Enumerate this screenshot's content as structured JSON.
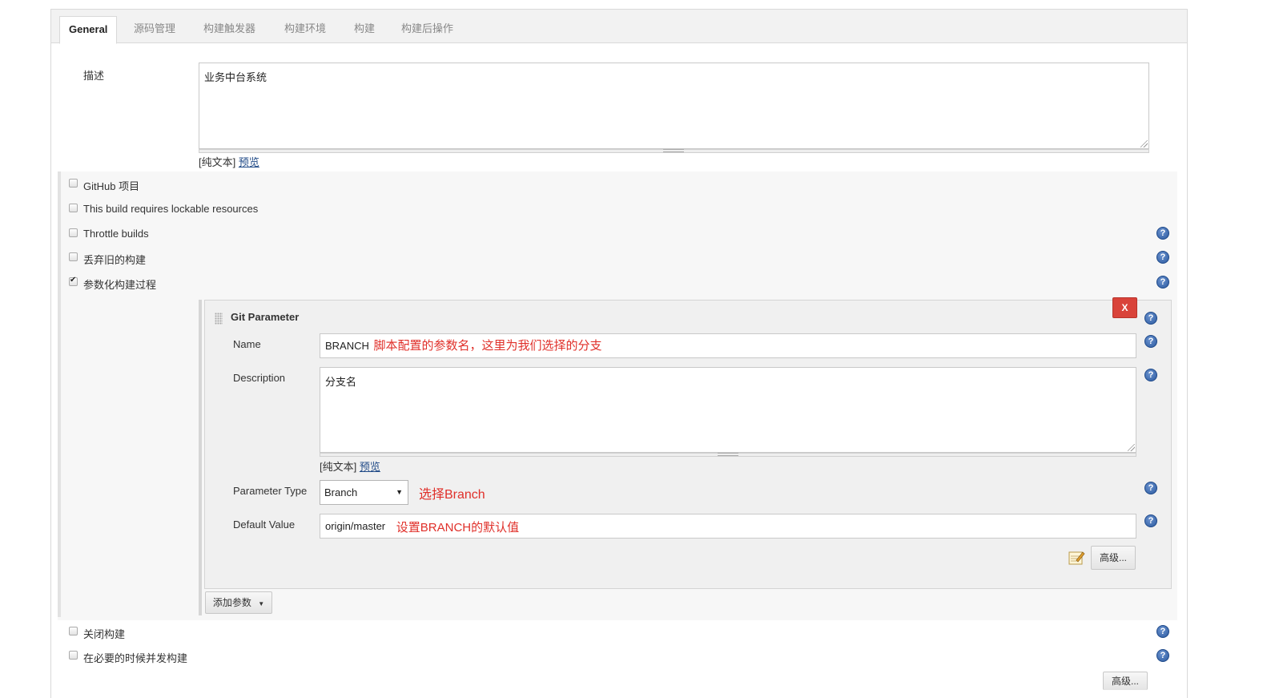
{
  "tabs": [
    "General",
    "源码管理",
    "构建触发器",
    "构建环境",
    "构建",
    "构建后操作"
  ],
  "description": {
    "label": "描述",
    "value": "业务中台系统",
    "plain_text": "[纯文本]",
    "preview": "预览"
  },
  "options": [
    {
      "label": "GitHub 项目",
      "checked": false
    },
    {
      "label": "This build requires lockable resources",
      "checked": false
    },
    {
      "label": "Throttle builds",
      "checked": false
    },
    {
      "label": "丢弃旧的构建",
      "checked": false
    },
    {
      "label": "参数化构建过程",
      "checked": true
    }
  ],
  "git_parameter": {
    "title": "Git Parameter",
    "delete_label": "X",
    "name_label": "Name",
    "name_value": "BRANCH",
    "name_note": "脚本配置的参数名，这里为我们选择的分支",
    "description_label": "Description",
    "description_value": "分支名",
    "plain_text": "[纯文本]",
    "preview": "预览",
    "type_label": "Parameter Type",
    "type_value": "Branch",
    "type_note": "选择Branch",
    "default_label": "Default Value",
    "default_value": "origin/master",
    "default_note": "设置BRANCH的默认值",
    "advanced_label": "高级..."
  },
  "add_param_label": "添加参数",
  "bottom_options": [
    {
      "label": "关闭构建",
      "checked": false
    },
    {
      "label": "在必要的时候并发构建",
      "checked": false
    }
  ],
  "bottom_advanced_label": "高级..."
}
